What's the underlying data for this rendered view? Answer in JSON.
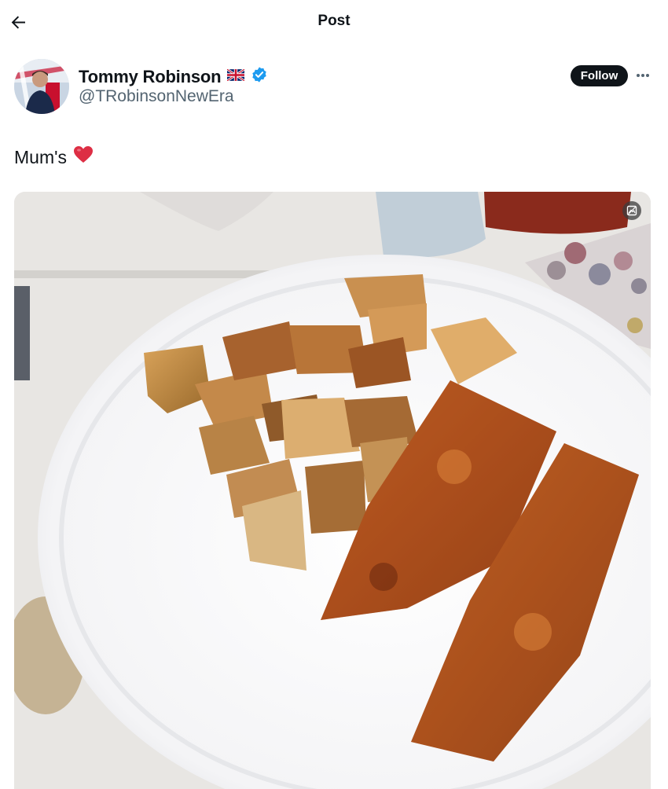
{
  "header": {
    "title": "Post",
    "back_icon": "arrow-left-icon"
  },
  "author": {
    "display_name": "Tommy Robinson",
    "flag_emoji": "🇬🇧",
    "verified": true,
    "verified_color": "#1d9bf0",
    "handle": "@TRobinsonNewEra"
  },
  "actions": {
    "follow_label": "Follow",
    "more_icon": "more-horizontal-icon"
  },
  "post": {
    "text": "Mum's",
    "emoji": "❤️"
  },
  "media": {
    "badge_icon": "alt-text-icon"
  },
  "colors": {
    "text": "#0f1419",
    "secondary_text": "#536471",
    "follow_bg": "#0f1419"
  }
}
